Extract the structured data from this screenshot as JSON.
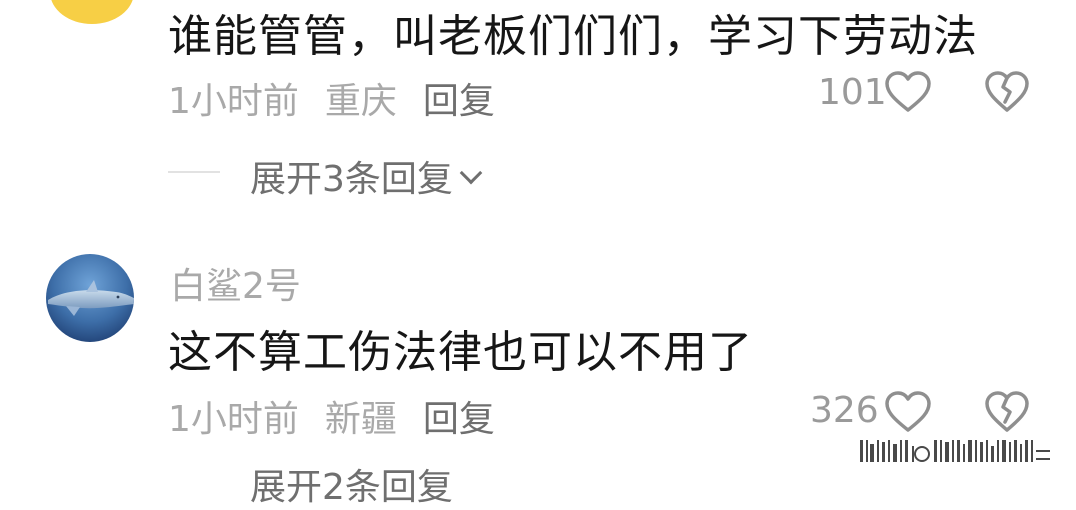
{
  "comments": [
    {
      "text": "谁能管管，叫老板们们们，学习下劳动法",
      "time": "1小时前",
      "location": "重庆",
      "reply_label": "回复",
      "likes": "101",
      "expand_label": "展开3条回复"
    },
    {
      "username": "白鲨2号",
      "text": "这不算工伤法律也可以不用了",
      "time": "1小时前",
      "location": "新疆",
      "reply_label": "回复",
      "likes": "326",
      "expand_label": "展开2条回复"
    }
  ],
  "icons": {
    "like": "heart-outline-icon",
    "dislike": "broken-heart-icon",
    "expand": "chevron-down-icon"
  },
  "colors": {
    "text_primary": "#161616",
    "text_secondary": "#a9a9a9",
    "text_action": "#6f6f6f",
    "avatar_yellow": "#f7cf45",
    "avatar_blue": "#3d6ea8"
  }
}
